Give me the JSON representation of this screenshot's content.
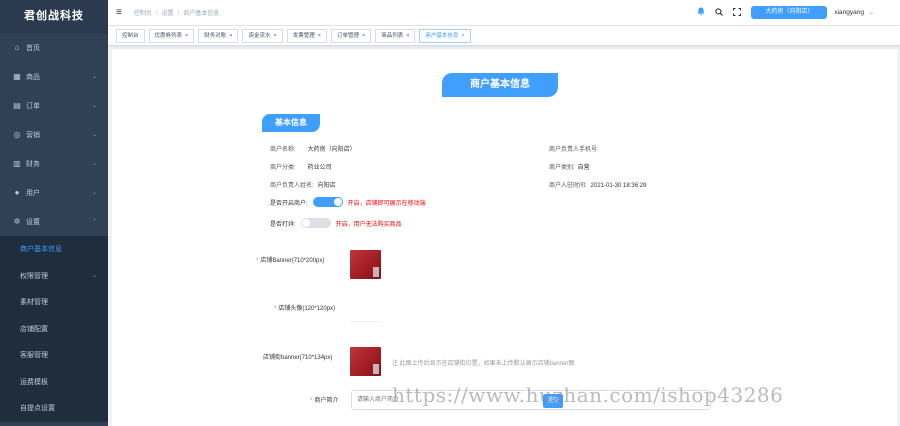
{
  "app": {
    "logo": "君创战科技"
  },
  "sidebar": {
    "items": [
      {
        "icon": "⌂",
        "label": "首页",
        "arrow": ""
      },
      {
        "icon": "▦",
        "label": "商品",
        "arrow": "⌄"
      },
      {
        "icon": "▤",
        "label": "订单",
        "arrow": "⌄"
      },
      {
        "icon": "◎",
        "label": "营销",
        "arrow": "⌄"
      },
      {
        "icon": "▥",
        "label": "财务",
        "arrow": "⌄"
      },
      {
        "icon": "●",
        "label": "用户",
        "arrow": "⌄"
      },
      {
        "icon": "✲",
        "label": "设置",
        "arrow": "⌃"
      }
    ],
    "sub_items": [
      {
        "label": "商户基本信息",
        "active": true
      },
      {
        "label": "权限管理",
        "arrow": "⌄"
      },
      {
        "label": "素材管理"
      },
      {
        "label": "店铺配置"
      },
      {
        "label": "客服管理"
      },
      {
        "label": "运费模板"
      },
      {
        "label": "自提点设置"
      }
    ]
  },
  "header": {
    "menu_icon": "≡",
    "breadcrumb": [
      "控制台",
      "设置",
      "商户基本信息"
    ],
    "store_button": "大药房（向阳店）",
    "username": "xiangyang",
    "icons": [
      "bell-icon",
      "search-icon",
      "fullscreen-icon"
    ]
  },
  "tags": [
    {
      "label": "控制台",
      "closable": false
    },
    {
      "label": "优惠券列表",
      "closable": true
    },
    {
      "label": "财务对账",
      "closable": true
    },
    {
      "label": "资金流水",
      "closable": true
    },
    {
      "label": "发票管理",
      "closable": true
    },
    {
      "label": "订单管理",
      "closable": true
    },
    {
      "label": "商品列表",
      "closable": true
    },
    {
      "label": "商户基本信息",
      "closable": true,
      "active": true
    }
  ],
  "page": {
    "title": "商户基本信息",
    "section": "基本信息",
    "info": {
      "name_label": "商户名称:",
      "name_value": "大药房（向阳店）",
      "category_label": "商户分类:",
      "category_value": "药业公司",
      "owner_label": "商户负责人姓名:",
      "owner_value": "向阳店",
      "phone_label": "商户负责人手机号:",
      "phone_value": "",
      "type_label": "商户类别:",
      "type_value": "自营",
      "join_label": "商户入驻时间:",
      "join_value": "2021-01-30 18:36:29"
    },
    "switches": {
      "open_label": "是否开启商户:",
      "open_hint": "开启，店铺即可展示在移动端",
      "open_on": true,
      "close_label": "是否打烊:",
      "close_hint": "开启，用户无法购买商品",
      "close_on": false
    },
    "images": {
      "banner_label": "店铺Banner(710*200px)",
      "avatar_label": "店铺头像(120*120px)",
      "street_label": "店铺街banner(710*134px)",
      "street_hint": "注:此图上传后显示在店铺街位置，如果未上传默认展示店铺banner图"
    },
    "intro_label": "商户简介",
    "intro_placeholder": "请输入商户简介",
    "submit_label": "提交"
  },
  "watermark": "https://www.huzhan.com/ishop43286",
  "colors": {
    "sidebar_bg": "#304156",
    "accent": "#409eff",
    "hint_red": "#ff0000"
  }
}
